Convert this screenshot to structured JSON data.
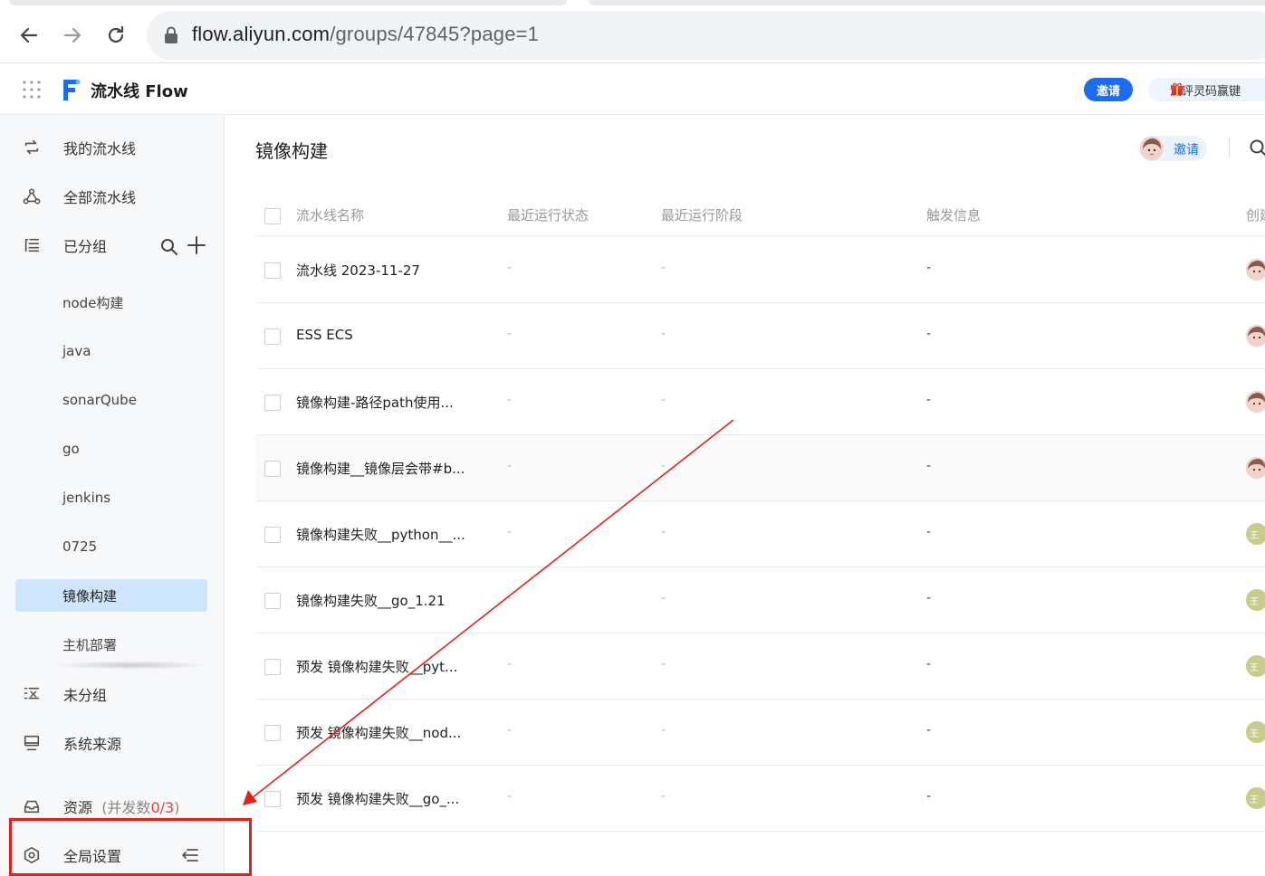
{
  "browser": {
    "url_host": "flow.aliyun.com",
    "url_path": "/groups/47845?page=1"
  },
  "header": {
    "app_name": "流水线 Flow",
    "invite_label": "邀请",
    "promo_text": "测评灵码赢键"
  },
  "sidebar": {
    "my_pipelines": "我的流水线",
    "all_pipelines": "全部流水线",
    "grouped": "已分组",
    "groups": [
      "node构建",
      "java",
      "sonarQube",
      "go",
      "jenkins",
      "0725",
      "镜像构建",
      "主机部署"
    ],
    "active_group": "镜像构建",
    "ungrouped": "未分组",
    "system_source": "系统来源",
    "resource_label": "资源",
    "resource_paren_open": "(并发数",
    "resource_count": "0/3",
    "resource_paren_close": ")",
    "global_settings": "全局设置"
  },
  "main": {
    "title": "镜像构建",
    "invite_label": "邀请",
    "columns": [
      "流水线名称",
      "最近运行状态",
      "最近运行阶段",
      "触发信息",
      "创建"
    ],
    "rows": [
      {
        "name": "流水线 2023-11-27",
        "status": "-",
        "stage": "-",
        "trigger": "-",
        "avatar": "face"
      },
      {
        "name": "ESS ECS",
        "status": "-",
        "stage": "-",
        "trigger": "-",
        "avatar": "face"
      },
      {
        "name": "镜像构建-路径path使用...",
        "status": "-",
        "stage": "-",
        "trigger": "-",
        "avatar": "face"
      },
      {
        "name": "镜像构建__镜像层会带#b...",
        "status": "-",
        "stage": "-",
        "trigger": "-",
        "avatar": "face"
      },
      {
        "name": "镜像构建失败__python__...",
        "status": "-",
        "stage": "-",
        "trigger": "-",
        "avatar": "王"
      },
      {
        "name": "镜像构建失败__go_1.21",
        "status": "-",
        "stage": "-",
        "trigger": "-",
        "avatar": "王"
      },
      {
        "name": "预发 镜像构建失败__pyt...",
        "status": "-",
        "stage": "-",
        "trigger": "-",
        "avatar": "王"
      },
      {
        "name": "预发 镜像构建失败__nod...",
        "status": "-",
        "stage": "-",
        "trigger": "-",
        "avatar": "王"
      },
      {
        "name": "预发 镜像构建失败__go_...",
        "status": "-",
        "stage": "-",
        "trigger": "-",
        "avatar": "王"
      }
    ]
  },
  "colors": {
    "accent": "#1b6cf2",
    "active_group_bg": "#cfe5fd",
    "annotation_red": "#e3211b",
    "resource_count": "#e8413a"
  }
}
